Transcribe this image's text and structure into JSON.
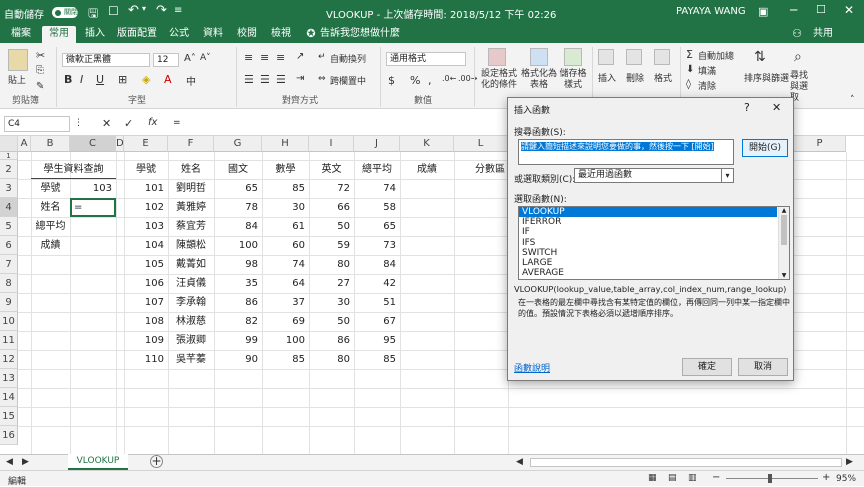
{
  "titlebar": {
    "autosave": "自動儲存",
    "autosave_state": "關閉",
    "doc_title": "VLOOKUP - 上次儲存時間: 2018/5/12 下午 02:26",
    "user": "PAYAYA WANG"
  },
  "tabs": [
    {
      "label": "檔案"
    },
    {
      "label": "常用"
    },
    {
      "label": "插入"
    },
    {
      "label": "版面配置"
    },
    {
      "label": "公式"
    },
    {
      "label": "資料"
    },
    {
      "label": "校閱"
    },
    {
      "label": "檢視"
    },
    {
      "label": "告訴我您想做什麼"
    }
  ],
  "share_label": "共用",
  "ribbon": {
    "paste": "貼上",
    "clipboard": "剪貼簿",
    "font_group": "字型",
    "align_group": "對齊方式",
    "number_group": "數值",
    "font_name": "微軟正黑體",
    "font_size": "12",
    "bold": "B",
    "italic": "I",
    "underline": "U",
    "wrap": "自動換列",
    "merge": "跨欄置中",
    "number_format": "通用格式",
    "currency": "$",
    "percent": "%",
    "comma": ",",
    "cond_format": "設定格式化的條件",
    "format_table": "格式化為表格",
    "cell_styles": "儲存格樣式",
    "insert": "插入",
    "delete": "刪除",
    "format": "格式",
    "autosum": "自動加總",
    "fill": "填滿",
    "clear": "清除",
    "sort": "排序與篩選",
    "find": "尋找與選取"
  },
  "formulabar": {
    "namebox": "C4",
    "fx": "fx",
    "content": "="
  },
  "columns": [
    "A",
    "B",
    "C",
    "D",
    "E",
    "F",
    "G",
    "H",
    "I",
    "J",
    "K",
    "L",
    "M",
    "N",
    "O",
    "P"
  ],
  "rows": [
    "1",
    "2",
    "3",
    "4",
    "5",
    "6",
    "7",
    "8",
    "9",
    "10",
    "11",
    "12",
    "13",
    "14",
    "15",
    "16"
  ],
  "lookup_panel": {
    "title": "學生資料查詢",
    "labels": [
      "學號",
      "姓名",
      "總平均",
      "成績"
    ],
    "id_value": "103",
    "active_value": "="
  },
  "table": {
    "headers": [
      "學號",
      "姓名",
      "國文",
      "數學",
      "英文",
      "總平均",
      "成績",
      "分數區"
    ],
    "rows": [
      [
        "101",
        "劉明哲",
        "65",
        "85",
        "72",
        "74"
      ],
      [
        "102",
        "黃雅婷",
        "78",
        "30",
        "66",
        "58"
      ],
      [
        "103",
        "蔡宜芳",
        "84",
        "61",
        "50",
        "65"
      ],
      [
        "104",
        "陳顗松",
        "100",
        "60",
        "59",
        "73"
      ],
      [
        "105",
        "戴菁如",
        "98",
        "74",
        "80",
        "84"
      ],
      [
        "106",
        "汪貞儀",
        "35",
        "64",
        "27",
        "42"
      ],
      [
        "107",
        "李承翰",
        "86",
        "37",
        "30",
        "51"
      ],
      [
        "108",
        "林淑慈",
        "82",
        "69",
        "50",
        "67"
      ],
      [
        "109",
        "張淑卿",
        "99",
        "100",
        "86",
        "95"
      ],
      [
        "110",
        "吳芊蓁",
        "90",
        "85",
        "80",
        "85"
      ]
    ]
  },
  "sheettabs": {
    "active": "VLOOKUP",
    "add": "+"
  },
  "status": {
    "mode": "編輯",
    "zoom": "95%"
  },
  "dialog": {
    "title": "插入函數",
    "help": "?",
    "close": "✕",
    "search_label": "搜尋函數(S):",
    "search_text": "請鍵入簡短描述來說明您要做的事，然後按一下 [開始]",
    "go": "開始(G)",
    "category_label": "或選取類別(C):",
    "category_value": "最近用過函數",
    "function_label": "選取函數(N):",
    "functions": [
      "VLOOKUP",
      "IFERROR",
      "IF",
      "IFS",
      "SWITCH",
      "LARGE",
      "AVERAGE"
    ],
    "signature": "VLOOKUP(lookup_value,table_array,col_index_num,range_lookup)",
    "description": "在一表格的最左欄中尋找含有某特定值的欄位，再傳回同一列中某一指定欄中的值。預設情況下表格必須以遞增順序排序。",
    "help_link": "函數說明",
    "ok": "確定",
    "cancel": "取消"
  }
}
